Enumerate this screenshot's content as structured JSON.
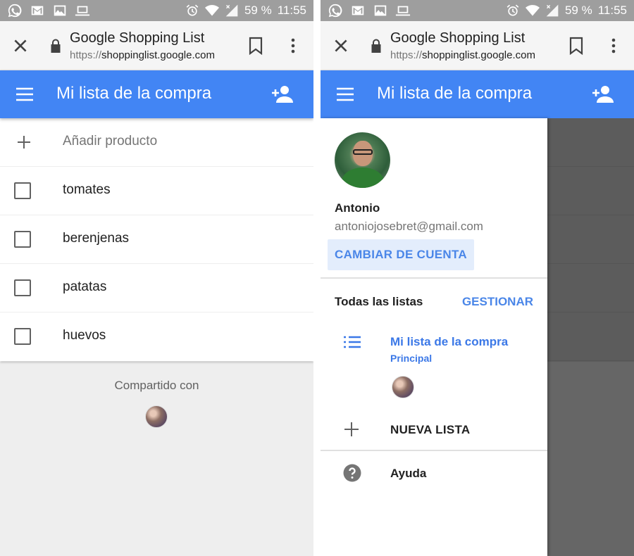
{
  "status_bar": {
    "battery": "59 %",
    "time": "11:55",
    "left_icons": [
      "whatsapp-icon",
      "gmail-icon",
      "image-icon",
      "laptop-icon"
    ],
    "right_icons": [
      "alarm-icon",
      "wifi-icon",
      "signal-off-icon"
    ]
  },
  "browser": {
    "page_title": "Google Shopping List",
    "url_scheme": "https://",
    "url_host": "shoppinglist.google.com"
  },
  "app_bar": {
    "title": "Mi lista de la compra"
  },
  "list": {
    "add_placeholder": "Añadir producto",
    "items": [
      {
        "label": "tomates",
        "checked": false
      },
      {
        "label": "berenjenas",
        "checked": false
      },
      {
        "label": "patatas",
        "checked": false
      },
      {
        "label": "huevos",
        "checked": false
      }
    ]
  },
  "footer": {
    "shared_with": "Compartido con"
  },
  "drawer": {
    "user_name": "Antonio",
    "user_email": "antoniojosebret@gmail.com",
    "switch_account": "CAMBIAR DE CUENTA",
    "all_lists": "Todas las listas",
    "manage": "GESTIONAR",
    "lists": [
      {
        "name": "Mi lista de la compra",
        "subtitle": "Principal"
      }
    ],
    "new_list": "NUEVA LISTA",
    "help": "Ayuda"
  },
  "colors": {
    "status_bar": "#9e9e9e",
    "app_bar": "#4285f4",
    "accent_text": "#4a86e8",
    "footer_bg": "#eeeeee",
    "scrim": "#666666"
  }
}
